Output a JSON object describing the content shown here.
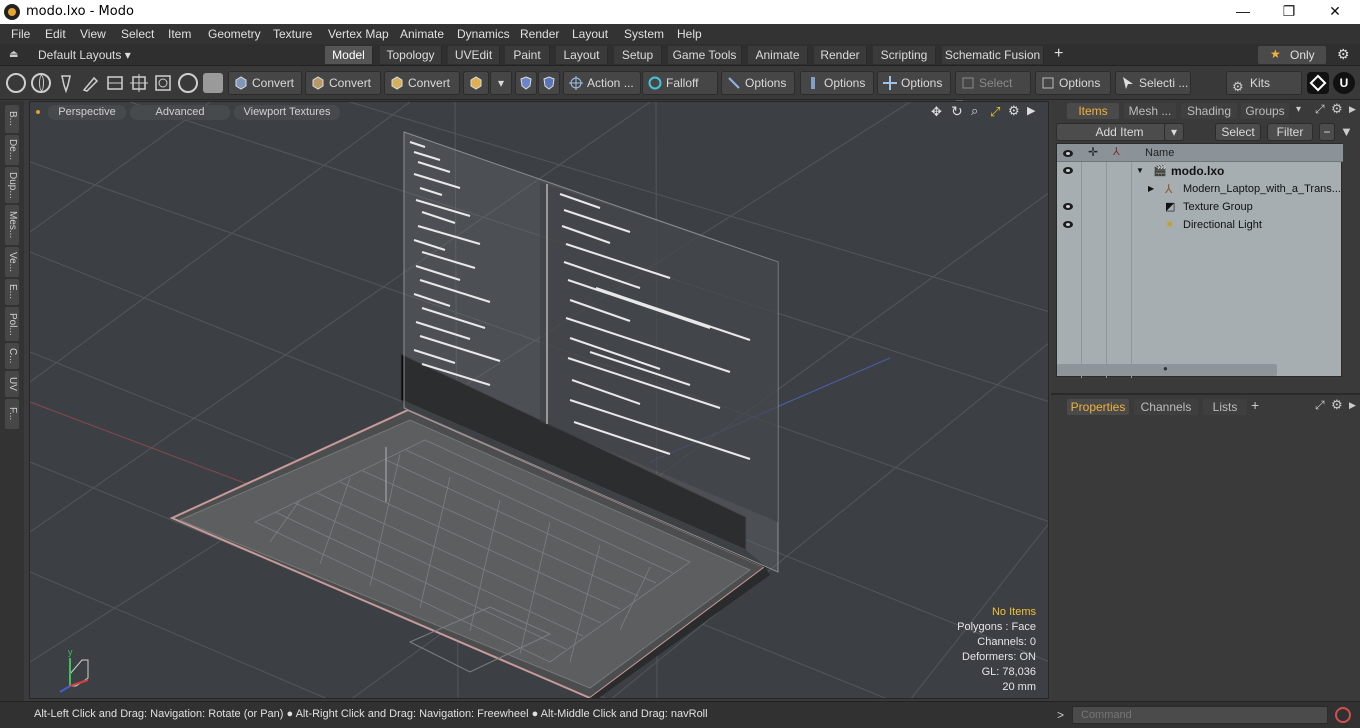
{
  "window": {
    "title": "modo.lxo - Modo",
    "minimize": "—",
    "maximize": "❐",
    "close": "✕"
  },
  "menu": [
    "File",
    "Edit",
    "View",
    "Select",
    "Item",
    "Geometry",
    "Texture",
    "Vertex Map",
    "Animate",
    "Dynamics",
    "Render",
    "Layout",
    "System",
    "Help"
  ],
  "layouts": {
    "selector": "Default Layouts ▾",
    "tabs": [
      "Model",
      "Topology",
      "UVEdit",
      "Paint",
      "Layout",
      "Setup",
      "Game Tools",
      "Animate",
      "Render",
      "Scripting",
      "Schematic Fusion"
    ],
    "active_tab": "Model",
    "add": "+",
    "only_label": "Only",
    "star": "★"
  },
  "toolbar": {
    "convert1": "Convert",
    "convert2": "Convert",
    "convert3": "Convert",
    "action": "Action",
    "action_more": "...",
    "falloff": "Falloff",
    "options1": "Options",
    "options2": "Options",
    "options3": "Options",
    "options4": "Options",
    "select_t": "Select T...",
    "selecti": "Selecti ...",
    "kits": "Kits"
  },
  "left_tabs": [
    "B...",
    "De...",
    "Dup...",
    "Mes...",
    "Ve...",
    "E...",
    "Pol...",
    "C...",
    "UV",
    "F..."
  ],
  "viewport": {
    "perspective": "Perspective",
    "advanced": "Advanced",
    "textures": "Viewport Textures",
    "stats": {
      "no_items": "No Items",
      "polygons": "Polygons : Face",
      "channels": "Channels: 0",
      "deformers": "Deformers: ON",
      "gl": "GL: 78,036",
      "scale": "20 mm"
    }
  },
  "items_panel": {
    "tabs": [
      "Items",
      "Mesh ...",
      "Shading",
      "Groups"
    ],
    "active_tab": "Items",
    "add_item": "Add Item",
    "select": "Select",
    "filter": "Filter",
    "name_header": "Name",
    "rows": [
      {
        "label": "modo.lxo",
        "visible": true
      },
      {
        "label": "Modern_Laptop_with_a_Trans...",
        "visible": false
      },
      {
        "label": "Texture Group",
        "visible": true
      },
      {
        "label": "Directional Light",
        "visible": true
      }
    ]
  },
  "props_panel": {
    "tabs": [
      "Properties",
      "Channels",
      "Lists"
    ],
    "active_tab": "Properties",
    "add": "+"
  },
  "status": {
    "hint": "Alt-Left Click and Drag: Navigation: Rotate (or Pan) ● Alt-Right Click and Drag: Navigation: Freewheel ● Alt-Middle Click and Drag: navRoll",
    "prompt": ">",
    "command_placeholder": "Command"
  },
  "colors": {
    "accent": "#f3b23b",
    "warning": "#f2c230",
    "laptop_edge": "#c79a98"
  }
}
